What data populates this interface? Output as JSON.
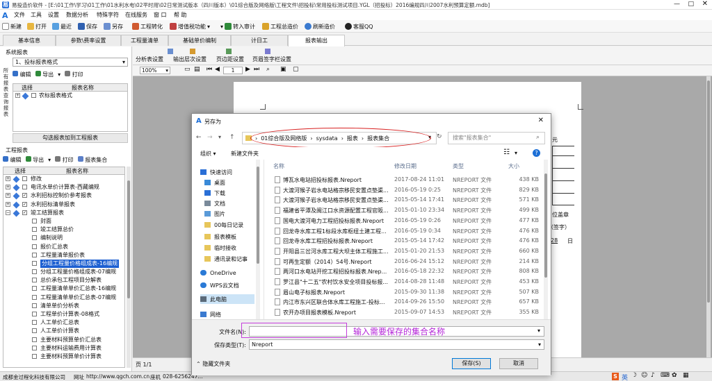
{
  "app": {
    "title": "易投造价软件 - [E:\\01工作\\学习\\01工作\\01水利水电\\02平时用\\02日常测试版本（四川版本）\\01综合版及网络版\\工程文件\\招投标\\常用投标测试项目.YGL（招投标）2016编规四川2007水利预算定额.mdb]",
    "menu": [
      "文件",
      "工具",
      "设置",
      "数据分析",
      "特殊字符",
      "在线服务",
      "窗 口",
      "帮 助"
    ],
    "toolbar": [
      "新建",
      "打开",
      "最近",
      "保存",
      "另存",
      "工程转化",
      "增值税功能",
      "转入审计",
      "工程总造价",
      "刷新造价",
      "客服QQ"
    ],
    "tabs": [
      "基本信息",
      "参数\\费率设置",
      "工程量清单",
      "基础单价编制",
      "计日工",
      "报表输出"
    ],
    "active_tab": "报表输出"
  },
  "left": {
    "sys_title": "系统报表",
    "format_select": "1、投标报表格式",
    "sys_tools": [
      "编辑",
      "导出",
      "打印"
    ],
    "grid_head": {
      "select": "选择",
      "name": "报表名称"
    },
    "sys_row": "农标报表格式",
    "add_button": "勾选报表加到工程报表",
    "side_tabs": [
      "所有报表",
      "查询报表"
    ],
    "proj_title": "工程报表",
    "proj_tools": [
      "编辑",
      "导出",
      "打印",
      "报表集合"
    ],
    "rows": [
      {
        "label": "修改",
        "level": 0,
        "checked": false,
        "expand": true
      },
      {
        "label": "电讯水单价计算表-西藏编规",
        "level": 0,
        "checked": false,
        "expand": true
      },
      {
        "label": "水利招标控制价参考报表",
        "level": 0,
        "checked": true,
        "expand": true
      },
      {
        "label": "水利招标清单报表",
        "level": 0,
        "checked": true,
        "expand": true
      },
      {
        "label": "竣工结算报表",
        "level": 0,
        "checked": true,
        "expand": true
      },
      {
        "label": "封面",
        "level": 1,
        "checked": false
      },
      {
        "label": "竣工结算总价",
        "level": 1,
        "checked": false
      },
      {
        "label": "编制说明",
        "level": 1,
        "checked": false
      },
      {
        "label": "报价汇总表",
        "level": 1,
        "checked": false
      },
      {
        "label": "工程量清单报价表",
        "level": 1,
        "checked": false
      },
      {
        "label": "分组工程量价格组成表-16编规",
        "level": 1,
        "checked": false,
        "selected": true
      },
      {
        "label": "分组工程量价格组成表-07编规",
        "level": 1,
        "checked": false
      },
      {
        "label": "总价承包工程项目分解表",
        "level": 1,
        "checked": false
      },
      {
        "label": "工程量清单单价汇总表-16编规",
        "level": 1,
        "checked": false
      },
      {
        "label": "工程量清单单价汇总表-07编规",
        "level": 1,
        "checked": false
      },
      {
        "label": "清单单价分析表",
        "level": 1,
        "checked": false
      },
      {
        "label": "工程单价计算表-08格式",
        "level": 1,
        "checked": false
      },
      {
        "label": "人工单价汇总表",
        "level": 1,
        "checked": false
      },
      {
        "label": "人工单价计算表",
        "level": 1,
        "checked": false
      },
      {
        "label": "主要材料预算单价汇总表",
        "level": 1,
        "checked": false
      },
      {
        "label": "主要材料运输费用计算表",
        "level": 1,
        "checked": false
      },
      {
        "label": "主要材料预算单价计算表",
        "level": 1,
        "checked": false
      }
    ]
  },
  "report": {
    "tools": [
      "分析表设置",
      "输出层次设置",
      "页边距设置",
      "页眉签字栏设置"
    ],
    "zoom": "100%",
    "page": "1",
    "status_page": "页 1/1",
    "paper_texts": [
      "元",
      "位盖章",
      "（签字）",
      "28",
      "日"
    ]
  },
  "footer": {
    "company": "成都金过程化科技有限公司",
    "website_label": "网址",
    "website": "http://www.qgch.com.cn",
    "fax_label": "座机",
    "fax": "028-6256247..."
  },
  "tray": {
    "ime": "英",
    "ime_icon": "S"
  },
  "dialog": {
    "title": "另存为",
    "breadcrumb": [
      "01综合版及网络版",
      "sysdata",
      "报表",
      "报表集合"
    ],
    "search_placeholder": "搜索\"报表集合\"",
    "organize": "组织",
    "new_folder": "新建文件夹",
    "nav": [
      {
        "label": "快速访问",
        "icon": "star"
      },
      {
        "label": "桌面",
        "icon": "desktop"
      },
      {
        "label": "下载",
        "icon": "download"
      },
      {
        "label": "文档",
        "icon": "doc"
      },
      {
        "label": "图片",
        "icon": "pic"
      },
      {
        "label": "00每日记录",
        "icon": "folder"
      },
      {
        "label": "报表模板",
        "icon": "folder"
      },
      {
        "label": "临时接收",
        "icon": "folder"
      },
      {
        "label": "通讯录和记事",
        "icon": "folder"
      },
      {
        "label": "OneDrive",
        "icon": "cloud"
      },
      {
        "label": "WPS云文档",
        "icon": "cloud"
      },
      {
        "label": "此电脑",
        "icon": "pc"
      },
      {
        "label": "网络",
        "icon": "net"
      }
    ],
    "columns": [
      "名称",
      "修改日期",
      "类型",
      "大小"
    ],
    "files": [
      {
        "name": "博瓦水电站招投标报表.Nreport",
        "date": "2017-08-24 11:01",
        "type": "NREPORT 文件",
        "size": "438 KB"
      },
      {
        "name": "大渡河猴子岩水电站格宗移民安置点垫渠...",
        "date": "2016-05-19 0:25",
        "type": "NREPORT 文件",
        "size": "829 KB"
      },
      {
        "name": "大渡河猴子岩水电站格宗移民安置点垫渠...",
        "date": "2015-05-14 17:41",
        "type": "NREPORT 文件",
        "size": "571 KB"
      },
      {
        "name": "福建省平潭及闽江口水资源配置工程官阪...",
        "date": "2015-01-10 23:34",
        "type": "NREPORT 文件",
        "size": "499 KB"
      },
      {
        "name": "国电大渡河电力工程招投标报表.Nreport",
        "date": "2016-05-19 0:26",
        "type": "NREPORT 文件",
        "size": "477 KB"
      },
      {
        "name": "回龙寺水库工程1标段水库枢纽土建工程...",
        "date": "2016-05-19 0:34",
        "type": "NREPORT 文件",
        "size": "476 KB"
      },
      {
        "name": "回龙寺水库工程招投标报表.Nreport",
        "date": "2015-05-14 17:42",
        "type": "NREPORT 文件",
        "size": "476 KB"
      },
      {
        "name": "开阳县三岔河水库工程大坝主体工程施工...",
        "date": "2015-01-20 21:53",
        "type": "NREPORT 文件",
        "size": "660 KB"
      },
      {
        "name": "可再生定额（2014）54号.Nreport",
        "date": "2016-06-24 15:12",
        "type": "NREPORT 文件",
        "size": "214 KB"
      },
      {
        "name": "两河口水电站开挖工程招投标报表.Nrep...",
        "date": "2016-05-18 22:32",
        "type": "NREPORT 文件",
        "size": "808 KB"
      },
      {
        "name": "罗江县\"十二五\"农村饮水安全项目投标报...",
        "date": "2014-08-28 11:48",
        "type": "NREPORT 文件",
        "size": "453 KB"
      },
      {
        "name": "眉山电子标报表.Nreport",
        "date": "2015-09-30 11:38",
        "type": "NREPORT 文件",
        "size": "507 KB"
      },
      {
        "name": "内江市东兴区联合体水库工程施工-投标...",
        "date": "2014-09-26 15:50",
        "type": "NREPORT 文件",
        "size": "657 KB"
      },
      {
        "name": "农开办项目报表模板.Nreport",
        "date": "2015-09-07 14:53",
        "type": "NREPORT 文件",
        "size": "355 KB"
      }
    ],
    "filename_label": "文件名(N):",
    "filename_value": "",
    "filetype_label": "保存类型(T):",
    "filetype_value": "Nreport",
    "hide_folders": "隐藏文件夹",
    "save": "保存(S)",
    "cancel": "取消",
    "annotation": "输入需要保存的集合名称"
  },
  "colors": {
    "accent": "#1c5fd1",
    "annotation": "#b426d8",
    "ellipse": "#d82020"
  }
}
